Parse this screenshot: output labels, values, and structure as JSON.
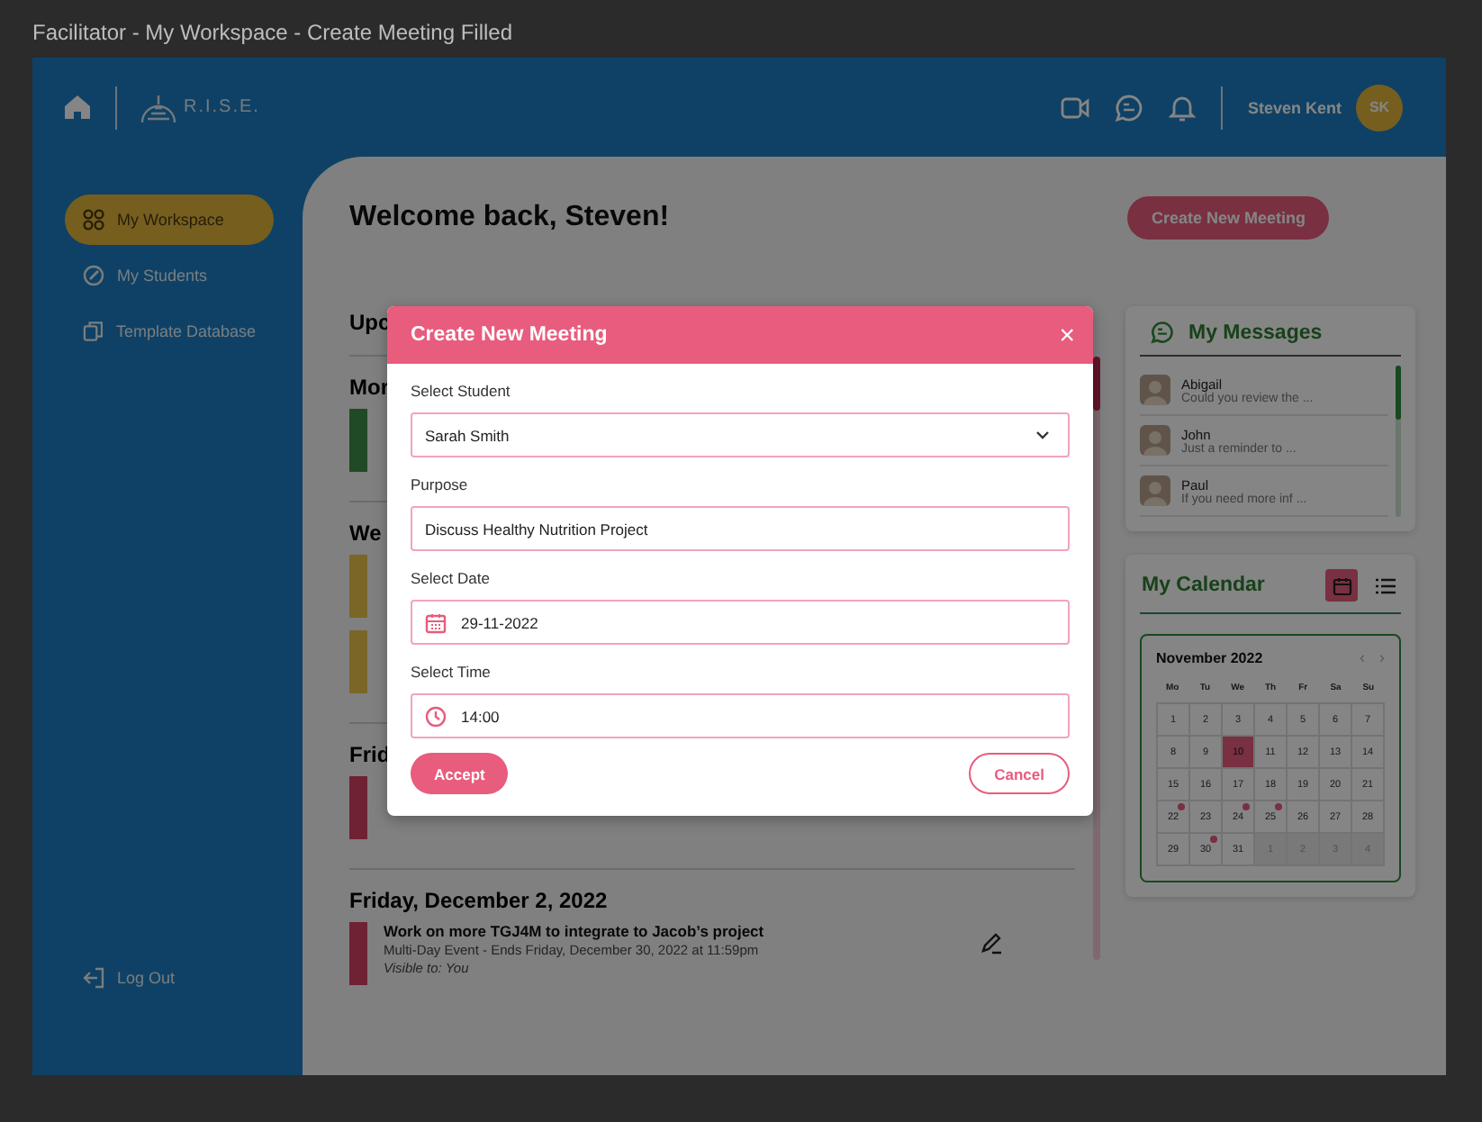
{
  "window": {
    "title": "Facilitator - My Workspace - Create Meeting Filled"
  },
  "header": {
    "logo_text": "R.I.S.E.",
    "user_name": "Steven Kent",
    "avatar_initials": "SK"
  },
  "sidebar": {
    "items": [
      {
        "label": "My Workspace",
        "kind": "grid",
        "selected": true
      },
      {
        "label": "My Students",
        "kind": "pen",
        "selected": false
      },
      {
        "label": "Template Database",
        "kind": "files",
        "selected": false
      }
    ],
    "logout": "Log Out"
  },
  "main": {
    "welcome": "Welcome back, Steven!",
    "create_button": "Create New Meeting",
    "sections": [
      {
        "heading": "Upc",
        "kind": "title"
      },
      {
        "heading": "Mor",
        "kind": "day",
        "events": [
          {
            "color": "#1f4a25"
          }
        ]
      },
      {
        "heading": "We",
        "kind": "day",
        "events": [
          {
            "color": "#7a6626"
          },
          {
            "color": "#7a6626"
          }
        ]
      },
      {
        "heading": "Frid",
        "kind": "day",
        "events": [
          {
            "color": "#6e2233"
          }
        ]
      },
      {
        "heading": "Friday, December 2, 2022",
        "kind": "day",
        "events": [
          {
            "color": "#6e2233",
            "title": "Work on more TGJ4M to integrate to Jacob’s project",
            "details": "Multi-Day Event - Ends Friday, December 30, 2022 at 11:59pm",
            "visibility": "Visible to: You"
          }
        ]
      }
    ]
  },
  "messages": {
    "title": "My Messages",
    "items": [
      {
        "name": "Abigail",
        "preview": "Could you review the ..."
      },
      {
        "name": "John",
        "preview": "Just a reminder to ..."
      },
      {
        "name": "Paul",
        "preview": "If you need more inf ..."
      }
    ]
  },
  "calendar": {
    "title": "My Calendar",
    "views": [
      {
        "kind": "calendar",
        "selected": true
      },
      {
        "kind": "list",
        "selected": false
      }
    ],
    "month": "November 2022",
    "prev": "‹",
    "next": "›",
    "weekdays": [
      "Mo",
      "Tu",
      "We",
      "Th",
      "Fr",
      "Sa",
      "Su"
    ],
    "days": [
      {
        "label": "1",
        "selected": false,
        "muted": false,
        "event": false
      },
      {
        "label": "2",
        "selected": false,
        "muted": false,
        "event": false
      },
      {
        "label": "3",
        "selected": false,
        "muted": false,
        "event": false
      },
      {
        "label": "4",
        "selected": false,
        "muted": false,
        "event": false
      },
      {
        "label": "5",
        "selected": false,
        "muted": false,
        "event": false
      },
      {
        "label": "6",
        "selected": false,
        "muted": false,
        "event": false
      },
      {
        "label": "7",
        "selected": false,
        "muted": false,
        "event": false
      },
      {
        "label": "8",
        "selected": false,
        "muted": false,
        "event": false
      },
      {
        "label": "9",
        "selected": false,
        "muted": false,
        "event": false
      },
      {
        "label": "10",
        "selected": true,
        "muted": false,
        "event": false
      },
      {
        "label": "11",
        "selected": false,
        "muted": false,
        "event": false
      },
      {
        "label": "12",
        "selected": false,
        "muted": false,
        "event": false
      },
      {
        "label": "13",
        "selected": false,
        "muted": false,
        "event": false
      },
      {
        "label": "14",
        "selected": false,
        "muted": false,
        "event": false
      },
      {
        "label": "15",
        "selected": false,
        "muted": false,
        "event": false
      },
      {
        "label": "16",
        "selected": false,
        "muted": false,
        "event": false
      },
      {
        "label": "17",
        "selected": false,
        "muted": false,
        "event": false
      },
      {
        "label": "18",
        "selected": false,
        "muted": false,
        "event": false
      },
      {
        "label": "19",
        "selected": false,
        "muted": false,
        "event": false
      },
      {
        "label": "20",
        "selected": false,
        "muted": false,
        "event": false
      },
      {
        "label": "21",
        "selected": false,
        "muted": false,
        "event": false
      },
      {
        "label": "22",
        "selected": false,
        "muted": false,
        "event": true
      },
      {
        "label": "23",
        "selected": false,
        "muted": false,
        "event": false
      },
      {
        "label": "24",
        "selected": false,
        "muted": false,
        "event": true
      },
      {
        "label": "25",
        "selected": false,
        "muted": false,
        "event": true
      },
      {
        "label": "26",
        "selected": false,
        "muted": false,
        "event": false
      },
      {
        "label": "27",
        "selected": false,
        "muted": false,
        "event": false
      },
      {
        "label": "28",
        "selected": false,
        "muted": false,
        "event": false
      },
      {
        "label": "29",
        "selected": false,
        "muted": false,
        "event": false
      },
      {
        "label": "30",
        "selected": false,
        "muted": false,
        "event": true
      },
      {
        "label": "31",
        "selected": false,
        "muted": false,
        "event": false
      },
      {
        "label": "1",
        "selected": false,
        "muted": true,
        "event": false
      },
      {
        "label": "2",
        "selected": false,
        "muted": true,
        "event": false
      },
      {
        "label": "3",
        "selected": false,
        "muted": true,
        "event": false
      },
      {
        "label": "4",
        "selected": false,
        "muted": true,
        "event": false
      }
    ]
  },
  "modal": {
    "title": "Create New Meeting",
    "close": "×",
    "fields": [
      {
        "label": "Select Student",
        "kind": "select",
        "value": "Sarah Smith"
      },
      {
        "label": "Purpose",
        "kind": "text",
        "value": "Discuss Healthy Nutrition Project"
      },
      {
        "label": "Select Date",
        "kind": "date",
        "value": "29-11-2022"
      },
      {
        "label": "Select Time",
        "kind": "time",
        "value": "14:00"
      }
    ],
    "accept": "Accept",
    "cancel": "Cancel"
  }
}
